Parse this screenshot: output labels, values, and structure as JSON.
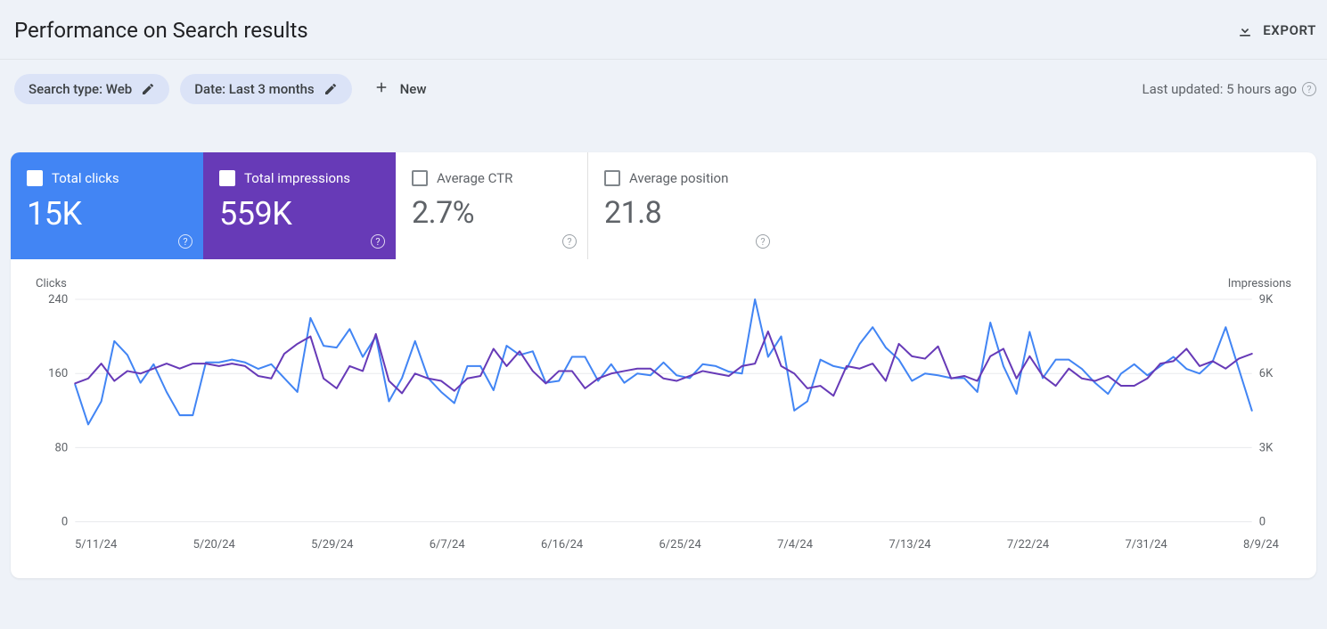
{
  "header": {
    "title": "Performance on Search results",
    "export_label": "EXPORT"
  },
  "filters": {
    "search_type_label": "Search type: Web",
    "date_label": "Date: Last 3 months",
    "new_label": "New",
    "last_updated": "Last updated: 5 hours ago"
  },
  "metrics": {
    "clicks": {
      "label": "Total clicks",
      "value": "15K",
      "checked": true
    },
    "impressions": {
      "label": "Total impressions",
      "value": "559K",
      "checked": true
    },
    "ctr": {
      "label": "Average CTR",
      "value": "2.7%",
      "checked": false
    },
    "position": {
      "label": "Average position",
      "value": "21.8",
      "checked": false
    }
  },
  "chart": {
    "left_axis_label": "Clicks",
    "right_axis_label": "Impressions",
    "left_ticks": [
      "240",
      "160",
      "80",
      "0"
    ],
    "right_ticks": [
      "9K",
      "6K",
      "3K",
      "0"
    ],
    "x_ticks": [
      "5/11/24",
      "5/20/24",
      "5/29/24",
      "6/7/24",
      "6/16/24",
      "6/25/24",
      "7/4/24",
      "7/13/24",
      "7/22/24",
      "7/31/24",
      "8/9/24"
    ]
  },
  "chart_data": {
    "type": "line",
    "title": "",
    "xlabel": "",
    "left_axis": {
      "label": "Clicks",
      "range": [
        0,
        240
      ]
    },
    "right_axis": {
      "label": "Impressions",
      "range": [
        0,
        9000
      ]
    },
    "x_tick_labels": [
      "5/11/24",
      "5/20/24",
      "5/29/24",
      "6/7/24",
      "6/16/24",
      "6/25/24",
      "7/4/24",
      "7/13/24",
      "7/22/24",
      "7/31/24",
      "8/9/24"
    ],
    "x_index_range": [
      0,
      90
    ],
    "series": [
      {
        "name": "Clicks",
        "axis": "left",
        "color": "#4285f4",
        "values": [
          148,
          105,
          130,
          195,
          180,
          150,
          170,
          140,
          115,
          115,
          172,
          172,
          175,
          172,
          165,
          170,
          155,
          140,
          220,
          190,
          188,
          208,
          178,
          200,
          130,
          155,
          195,
          155,
          140,
          128,
          168,
          168,
          142,
          190,
          180,
          184,
          150,
          152,
          178,
          178,
          152,
          170,
          150,
          160,
          158,
          172,
          158,
          155,
          170,
          168,
          162,
          160,
          240,
          178,
          200,
          120,
          130,
          175,
          168,
          165,
          192,
          210,
          188,
          175,
          152,
          160,
          158,
          155,
          155,
          140,
          215,
          168,
          138,
          205,
          155,
          175,
          175,
          165,
          150,
          138,
          160,
          170,
          158,
          168,
          178,
          165,
          160,
          173,
          210,
          165,
          120
        ]
      },
      {
        "name": "Impressions",
        "axis": "right",
        "color": "#673ab7",
        "values": [
          5600,
          5800,
          6400,
          5700,
          6100,
          6000,
          6200,
          6400,
          6200,
          6400,
          6400,
          6300,
          6400,
          6300,
          5900,
          5800,
          6800,
          7200,
          7500,
          5800,
          5400,
          6300,
          6100,
          7600,
          5700,
          5200,
          6000,
          5800,
          5700,
          5300,
          5800,
          5900,
          7000,
          6300,
          6900,
          6100,
          5600,
          6100,
          6100,
          5400,
          5800,
          6000,
          6100,
          6200,
          6200,
          5800,
          5700,
          5900,
          6100,
          6000,
          5900,
          6300,
          6400,
          7700,
          6300,
          6000,
          5400,
          5500,
          5100,
          6300,
          6200,
          6400,
          5700,
          7200,
          6700,
          6600,
          7100,
          5800,
          5900,
          5700,
          6700,
          7000,
          5800,
          6700,
          5900,
          5500,
          6200,
          5800,
          5700,
          5900,
          5500,
          5500,
          5800,
          6400,
          6500,
          7000,
          6300,
          6500,
          6200,
          6600,
          6800
        ]
      }
    ]
  }
}
